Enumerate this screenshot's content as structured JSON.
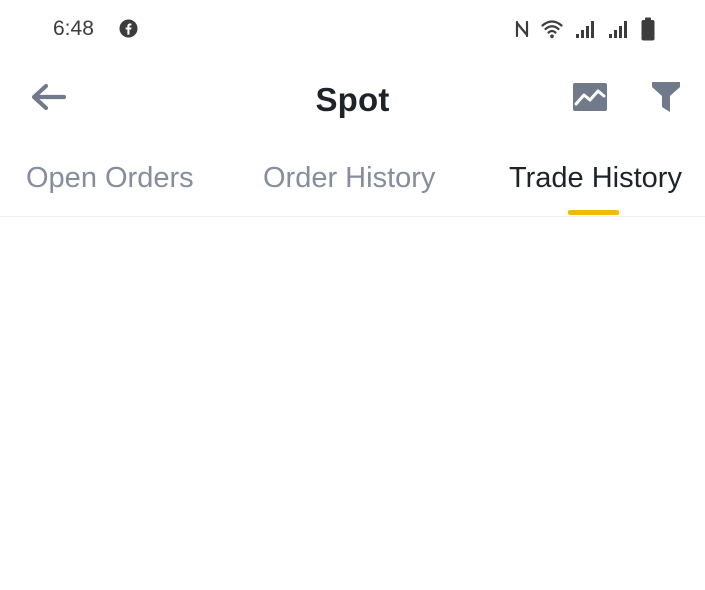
{
  "status_bar": {
    "time": "6:48",
    "icons": [
      "facebook-icon",
      "nfc-icon",
      "wifi-icon",
      "signal-icon",
      "signal-icon",
      "battery-icon"
    ]
  },
  "header": {
    "title": "Spot",
    "back_icon": "arrow-left-icon",
    "chart_icon": "chart-icon",
    "filter_icon": "filter-icon"
  },
  "tabs": [
    {
      "label": "Open Orders",
      "active": false
    },
    {
      "label": "Order History",
      "active": false
    },
    {
      "label": "Trade History",
      "active": true
    }
  ],
  "colors": {
    "accent": "#f0b90b",
    "text_primary": "#1e2329",
    "text_secondary": "#848e9c",
    "icon_gray": "#707a8a"
  }
}
